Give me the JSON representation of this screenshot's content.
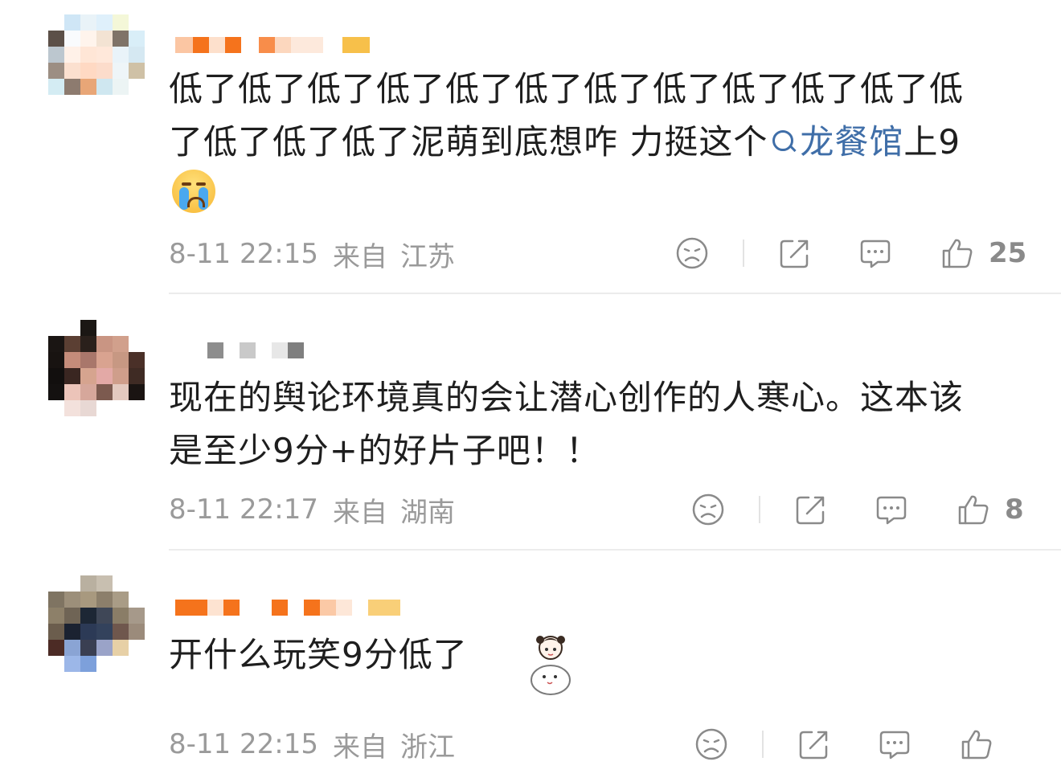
{
  "comments": [
    {
      "text_lines": [
        "低了低了低了低了低了低了低了低了低了低了低了低",
        "了低了低了低了泥萌到底想咋 力挺这个"
      ],
      "topic": "龙餐馆",
      "text_after_topic": "上9",
      "emoji": "crying-face-icon",
      "time": "8-11 22:15",
      "from_label": "来自",
      "location": "江苏",
      "like_count": "25"
    },
    {
      "text_lines": [
        "现在的舆论环境真的会让潜心创作的人寒心。这本该",
        "是至少9分+的好片子吧！！"
      ],
      "time": "8-11 22:17",
      "from_label": "来自",
      "location": "湖南",
      "like_count": "8"
    },
    {
      "text_lines": [
        "开什么玩笑9分低了"
      ],
      "sticker": "girl-and-cat-sticker-icon",
      "time": "8-11 22:15",
      "from_label": "来自",
      "location": "浙江",
      "like_count": ""
    }
  ],
  "icons": {
    "dislike": "sad-face-icon",
    "share": "share-icon",
    "reply": "comment-bubble-icon",
    "like": "thumbs-up-icon"
  },
  "colors": {
    "topic_link": "#3f6ea8",
    "meta_text": "#9a9a9a",
    "username_orange": "#f5731c"
  }
}
